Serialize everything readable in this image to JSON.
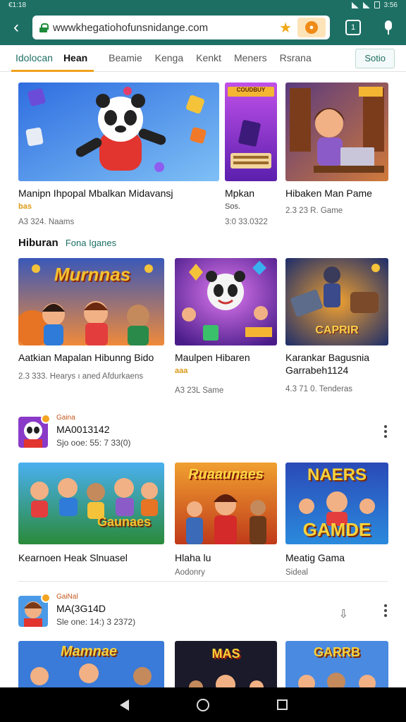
{
  "status": {
    "time": "€1:18",
    "clock": "3:56"
  },
  "browser": {
    "url": "wwwkhegаtiohofunsnidange.com",
    "tab_count": "1"
  },
  "categories": {
    "items": [
      "Idolocan",
      "Hean",
      "Beamie",
      "Kenga",
      "Kenkt",
      "Meners",
      "Rsrana"
    ],
    "go_label": "Sotio"
  },
  "row1": {
    "cards": [
      {
        "title": "Manipn Ihpopal Mbalkan Midavansj",
        "sub": "bas",
        "meta": "A3 324. Naams",
        "banner": ""
      },
      {
        "title": "Mpkan",
        "sub": "Sos.",
        "meta": "3:0 33.0322",
        "banner": "COUDBUY"
      },
      {
        "title": "Hibaken Man Pame",
        "sub": "",
        "meta": "2.3 23 R. Game",
        "banner": ""
      }
    ]
  },
  "section": {
    "title": "Hiburan",
    "accent": "Fona Iganes"
  },
  "row2": {
    "cards": [
      {
        "title": "Aatkian Mapalan Hibunng Bido",
        "sub": "",
        "meta": "2.3 333. Hearys ı aned Afdurkaens",
        "banner": "Murnnas"
      },
      {
        "title": "Maulpen Hibaren",
        "sub": "aaa",
        "meta": "A3 23L Same",
        "banner": ""
      },
      {
        "title": "Karankar Bagusnia Garrabeh1124",
        "sub": "",
        "meta": "4.3 71 0. Tenderas",
        "banner": "CAPRIR"
      }
    ]
  },
  "publisher1": {
    "tag": "Gaina",
    "name": "MA0013142",
    "meta": "Sjo ooe: 55: 7 33(0)"
  },
  "row3": {
    "cards": [
      {
        "title": "Kearnoen Heak Slnuasel",
        "sub": "",
        "meta": "",
        "banner": "Gaunaes"
      },
      {
        "title": "Hlaha lu",
        "sub": "",
        "meta": "Aodonry",
        "banner": "Ruaaunaes"
      },
      {
        "title": "Meatig Gama",
        "sub": "",
        "meta": "Sideal",
        "banner": "NAERS"
      }
    ]
  },
  "publisher2": {
    "tag": "GaiNal",
    "name": "MA(3G14D",
    "meta": "Sle one: 14:) 3 2372)"
  },
  "row4": {
    "cards": [
      {
        "banner": "Mamnae"
      },
      {
        "banner": "MAS"
      },
      {
        "banner": "GARRB"
      }
    ]
  },
  "colors": {
    "toolbar": "#1d6f64",
    "accent": "#f0a21c",
    "nav": "#000000"
  }
}
